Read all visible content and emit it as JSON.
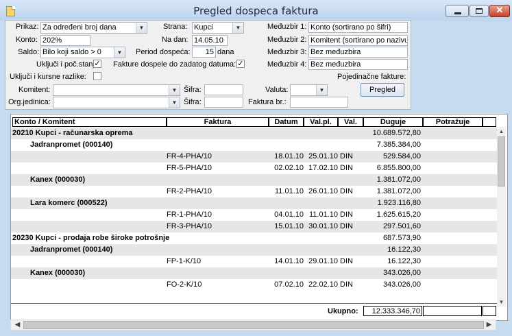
{
  "window": {
    "title": "Pregled dospeca faktura"
  },
  "filters": {
    "prikaz_label": "Prikaz:",
    "prikaz_value": "Za određeni broj dana",
    "konto_label": "Konto:",
    "konto_value": "202%",
    "saldo_label": "Saldo:",
    "saldo_value": "Bilo koji saldo > 0",
    "ukljuci_poc_label": "Uključi i poč.stanje:",
    "ukljuci_poc_checked": "✓",
    "ukljuci_kurs_label": "Uključi i kursne razlike:",
    "ukljuci_kurs_checked": "",
    "strana_label": "Strana:",
    "strana_value": "Kupci",
    "na_dan_label": "Na dan:",
    "na_dan_value": "14.05.10",
    "period_label": "Period dospeća:",
    "period_value": "15",
    "period_unit": "dana",
    "fakture_dospele_label": "Fakture dospele do zadatog datuma:",
    "fakture_dospele_checked": "✓",
    "medjuzbir1_label": "Međuzbir 1:",
    "medjuzbir1_value": "Konto (sortirano po šifri)",
    "medjuzbir2_label": "Međuzbir 2:",
    "medjuzbir2_value": "Komitent (sortirano po nazivu)",
    "medjuzbir3_label": "Međuzbir 3:",
    "medjuzbir3_value": "Bez međuzbira",
    "medjuzbir4_label": "Međuzbir 4:",
    "medjuzbir4_value": "Bez međuzbira",
    "pojedinacne_label": "Pojedinačne fakture:",
    "pregled_button": "Pregled",
    "komitent_label": "Komitent:",
    "komitent_value": "",
    "sifra1_label": "Šifra:",
    "sifra1_value": "",
    "valuta_label": "Valuta:",
    "valuta_value": "",
    "orgjed_label": "Org.jedinica:",
    "orgjed_value": "",
    "sifra2_label": "Šifra:",
    "sifra2_value": "",
    "faktura_br_label": "Faktura br.:",
    "faktura_br_value": ""
  },
  "table": {
    "headers": [
      "Konto / Komitent",
      "Faktura",
      "Datum",
      "Val.pl.",
      "Val.",
      "Duguje",
      "Potražuje"
    ],
    "rows": [
      {
        "kind": "group",
        "col0": "20210  Kupci - računarska oprema",
        "faktura": "",
        "datum": "",
        "valpl": "",
        "val": "",
        "duguje": "10.689.572,80",
        "potrazuje": ""
      },
      {
        "kind": "sub",
        "col0": "Jadranpromet  (000140)",
        "faktura": "",
        "datum": "",
        "valpl": "",
        "val": "",
        "duguje": "7.385.384,00",
        "potrazuje": ""
      },
      {
        "kind": "item",
        "col0": "",
        "faktura": "FR-4-PHA/10",
        "datum": "18.01.10",
        "valpl": "25.01.10",
        "val": "DIN",
        "duguje": "529.584,00",
        "potrazuje": ""
      },
      {
        "kind": "item",
        "col0": "",
        "faktura": "FR-5-PHA/10",
        "datum": "02.02.10",
        "valpl": "17.02.10",
        "val": "DIN",
        "duguje": "6.855.800,00",
        "potrazuje": ""
      },
      {
        "kind": "sub",
        "col0": "Kanex  (000030)",
        "faktura": "",
        "datum": "",
        "valpl": "",
        "val": "",
        "duguje": "1.381.072,00",
        "potrazuje": ""
      },
      {
        "kind": "item",
        "col0": "",
        "faktura": "FR-2-PHA/10",
        "datum": "11.01.10",
        "valpl": "26.01.10",
        "val": "DIN",
        "duguje": "1.381.072,00",
        "potrazuje": ""
      },
      {
        "kind": "sub",
        "col0": "Lara komerc  (000522)",
        "faktura": "",
        "datum": "",
        "valpl": "",
        "val": "",
        "duguje": "1.923.116,80",
        "potrazuje": ""
      },
      {
        "kind": "item",
        "col0": "",
        "faktura": "FR-1-PHA/10",
        "datum": "04.01.10",
        "valpl": "11.01.10",
        "val": "DIN",
        "duguje": "1.625.615,20",
        "potrazuje": ""
      },
      {
        "kind": "item",
        "col0": "",
        "faktura": "FR-3-PHA/10",
        "datum": "15.01.10",
        "valpl": "30.01.10",
        "val": "DIN",
        "duguje": "297.501,60",
        "potrazuje": ""
      },
      {
        "kind": "group",
        "col0": "20230  Kupci - prodaja robe široke potrošnje",
        "faktura": "",
        "datum": "",
        "valpl": "",
        "val": "",
        "duguje": "687.573,90",
        "potrazuje": ""
      },
      {
        "kind": "sub",
        "col0": "Jadranpromet  (000140)",
        "faktura": "",
        "datum": "",
        "valpl": "",
        "val": "",
        "duguje": "16.122,30",
        "potrazuje": ""
      },
      {
        "kind": "item",
        "col0": "",
        "faktura": "FP-1-K/10",
        "datum": "14.01.10",
        "valpl": "29.01.10",
        "val": "DIN",
        "duguje": "16.122,30",
        "potrazuje": ""
      },
      {
        "kind": "sub",
        "col0": "Kanex  (000030)",
        "faktura": "",
        "datum": "",
        "valpl": "",
        "val": "",
        "duguje": "343.026,00",
        "potrazuje": ""
      },
      {
        "kind": "item",
        "col0": "",
        "faktura": "FO-2-K/10",
        "datum": "07.02.10",
        "valpl": "22.02.10",
        "val": "DIN",
        "duguje": "343.026,00",
        "potrazuje": ""
      }
    ],
    "total_label": "Ukupno:",
    "total_duguje": "12.333.346,70",
    "total_potrazuje": ""
  }
}
